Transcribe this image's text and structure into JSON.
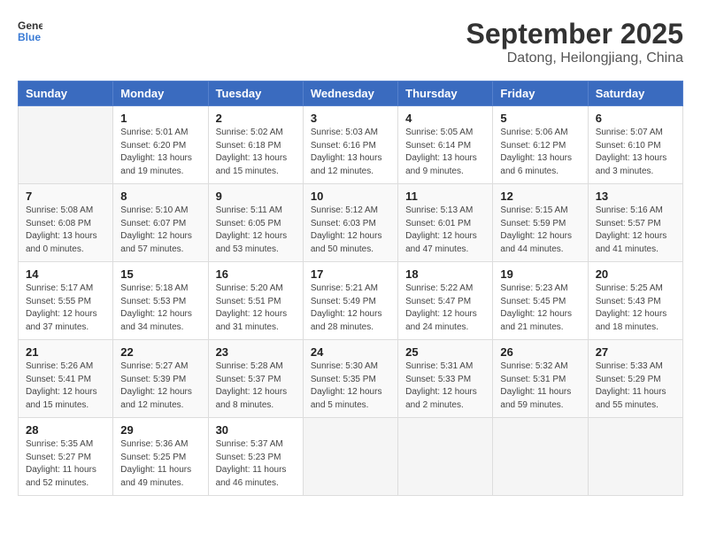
{
  "header": {
    "logo_line1": "General",
    "logo_line2": "Blue",
    "month": "September 2025",
    "location": "Datong, Heilongjiang, China"
  },
  "weekdays": [
    "Sunday",
    "Monday",
    "Tuesday",
    "Wednesday",
    "Thursday",
    "Friday",
    "Saturday"
  ],
  "weeks": [
    [
      {
        "day": "",
        "info": ""
      },
      {
        "day": "1",
        "info": "Sunrise: 5:01 AM\nSunset: 6:20 PM\nDaylight: 13 hours\nand 19 minutes."
      },
      {
        "day": "2",
        "info": "Sunrise: 5:02 AM\nSunset: 6:18 PM\nDaylight: 13 hours\nand 15 minutes."
      },
      {
        "day": "3",
        "info": "Sunrise: 5:03 AM\nSunset: 6:16 PM\nDaylight: 13 hours\nand 12 minutes."
      },
      {
        "day": "4",
        "info": "Sunrise: 5:05 AM\nSunset: 6:14 PM\nDaylight: 13 hours\nand 9 minutes."
      },
      {
        "day": "5",
        "info": "Sunrise: 5:06 AM\nSunset: 6:12 PM\nDaylight: 13 hours\nand 6 minutes."
      },
      {
        "day": "6",
        "info": "Sunrise: 5:07 AM\nSunset: 6:10 PM\nDaylight: 13 hours\nand 3 minutes."
      }
    ],
    [
      {
        "day": "7",
        "info": "Sunrise: 5:08 AM\nSunset: 6:08 PM\nDaylight: 13 hours\nand 0 minutes."
      },
      {
        "day": "8",
        "info": "Sunrise: 5:10 AM\nSunset: 6:07 PM\nDaylight: 12 hours\nand 57 minutes."
      },
      {
        "day": "9",
        "info": "Sunrise: 5:11 AM\nSunset: 6:05 PM\nDaylight: 12 hours\nand 53 minutes."
      },
      {
        "day": "10",
        "info": "Sunrise: 5:12 AM\nSunset: 6:03 PM\nDaylight: 12 hours\nand 50 minutes."
      },
      {
        "day": "11",
        "info": "Sunrise: 5:13 AM\nSunset: 6:01 PM\nDaylight: 12 hours\nand 47 minutes."
      },
      {
        "day": "12",
        "info": "Sunrise: 5:15 AM\nSunset: 5:59 PM\nDaylight: 12 hours\nand 44 minutes."
      },
      {
        "day": "13",
        "info": "Sunrise: 5:16 AM\nSunset: 5:57 PM\nDaylight: 12 hours\nand 41 minutes."
      }
    ],
    [
      {
        "day": "14",
        "info": "Sunrise: 5:17 AM\nSunset: 5:55 PM\nDaylight: 12 hours\nand 37 minutes."
      },
      {
        "day": "15",
        "info": "Sunrise: 5:18 AM\nSunset: 5:53 PM\nDaylight: 12 hours\nand 34 minutes."
      },
      {
        "day": "16",
        "info": "Sunrise: 5:20 AM\nSunset: 5:51 PM\nDaylight: 12 hours\nand 31 minutes."
      },
      {
        "day": "17",
        "info": "Sunrise: 5:21 AM\nSunset: 5:49 PM\nDaylight: 12 hours\nand 28 minutes."
      },
      {
        "day": "18",
        "info": "Sunrise: 5:22 AM\nSunset: 5:47 PM\nDaylight: 12 hours\nand 24 minutes."
      },
      {
        "day": "19",
        "info": "Sunrise: 5:23 AM\nSunset: 5:45 PM\nDaylight: 12 hours\nand 21 minutes."
      },
      {
        "day": "20",
        "info": "Sunrise: 5:25 AM\nSunset: 5:43 PM\nDaylight: 12 hours\nand 18 minutes."
      }
    ],
    [
      {
        "day": "21",
        "info": "Sunrise: 5:26 AM\nSunset: 5:41 PM\nDaylight: 12 hours\nand 15 minutes."
      },
      {
        "day": "22",
        "info": "Sunrise: 5:27 AM\nSunset: 5:39 PM\nDaylight: 12 hours\nand 12 minutes."
      },
      {
        "day": "23",
        "info": "Sunrise: 5:28 AM\nSunset: 5:37 PM\nDaylight: 12 hours\nand 8 minutes."
      },
      {
        "day": "24",
        "info": "Sunrise: 5:30 AM\nSunset: 5:35 PM\nDaylight: 12 hours\nand 5 minutes."
      },
      {
        "day": "25",
        "info": "Sunrise: 5:31 AM\nSunset: 5:33 PM\nDaylight: 12 hours\nand 2 minutes."
      },
      {
        "day": "26",
        "info": "Sunrise: 5:32 AM\nSunset: 5:31 PM\nDaylight: 11 hours\nand 59 minutes."
      },
      {
        "day": "27",
        "info": "Sunrise: 5:33 AM\nSunset: 5:29 PM\nDaylight: 11 hours\nand 55 minutes."
      }
    ],
    [
      {
        "day": "28",
        "info": "Sunrise: 5:35 AM\nSunset: 5:27 PM\nDaylight: 11 hours\nand 52 minutes."
      },
      {
        "day": "29",
        "info": "Sunrise: 5:36 AM\nSunset: 5:25 PM\nDaylight: 11 hours\nand 49 minutes."
      },
      {
        "day": "30",
        "info": "Sunrise: 5:37 AM\nSunset: 5:23 PM\nDaylight: 11 hours\nand 46 minutes."
      },
      {
        "day": "",
        "info": ""
      },
      {
        "day": "",
        "info": ""
      },
      {
        "day": "",
        "info": ""
      },
      {
        "day": "",
        "info": ""
      }
    ]
  ]
}
